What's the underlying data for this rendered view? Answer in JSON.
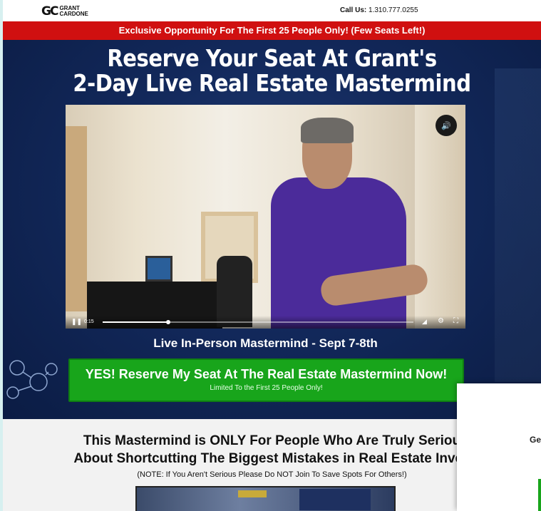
{
  "header": {
    "logo_mark": "GC",
    "logo_text": "GRANT CARDONE",
    "call_label": "Call Us:",
    "phone": "1.310.777.0255"
  },
  "banner": {
    "text": "Exclusive Opportunity For The First 25 People Only! (Few Seats Left!)"
  },
  "hero": {
    "title_line1": "Reserve Your Seat At Grant's",
    "title_line2": "2-Day Live Real Estate Mastermind",
    "event_line": "Live In-Person Mastermind - Sept 7-8th"
  },
  "video": {
    "current_time": "0:15",
    "progress": 0.21,
    "volume_icon": "🔊"
  },
  "cta": {
    "main_label": "YES! Reserve My Seat At The Real Estate Mastermind Now!",
    "sub_label": "Limited To the First 25 People Only!"
  },
  "lower": {
    "heading_line1": "This Mastermind is ONLY For People Who Are Truly Seriou",
    "heading_line2": "About Shortcutting The Biggest Mistakes in Real Estate Inves",
    "note": "(NOTE: If You Aren't Serious Please Do NOT Join To Save Spots For Others!)"
  },
  "popup": {
    "text": "Ge"
  },
  "colors": {
    "banner_red": "#d01010",
    "hero_blue": "#12285a",
    "cta_green": "#18a51b"
  }
}
